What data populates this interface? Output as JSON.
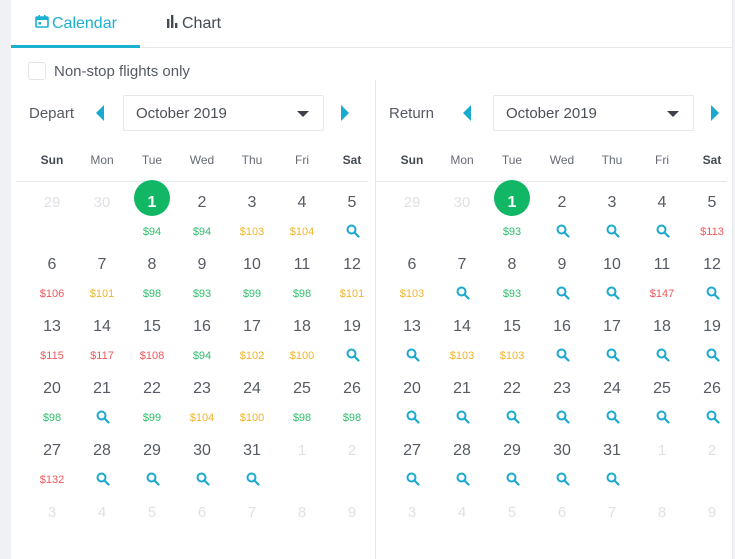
{
  "tabs": [
    {
      "label": "Calendar",
      "icon": "calendar-icon",
      "active": true
    },
    {
      "label": "Chart",
      "icon": "bar-chart-icon",
      "active": false
    }
  ],
  "nonstop": {
    "label": "Non-stop flights only",
    "checked": false
  },
  "colors": {
    "accent": "#1ab0d0",
    "selected": "#12b765",
    "green": "#2fbf6c",
    "orange": "#f0b429",
    "red": "#f2575d"
  },
  "weekdays": [
    "Sun",
    "Mon",
    "Tue",
    "Wed",
    "Thu",
    "Fri",
    "Sat"
  ],
  "calendars": [
    {
      "id": "depart",
      "label": "Depart",
      "month": "October 2019",
      "days": [
        {
          "d": "29",
          "other": true
        },
        {
          "d": "30",
          "other": true
        },
        {
          "d": "1",
          "price": "$94",
          "tier": "green",
          "selected": true
        },
        {
          "d": "2",
          "price": "$94",
          "tier": "green"
        },
        {
          "d": "3",
          "price": "$103",
          "tier": "orange"
        },
        {
          "d": "4",
          "price": "$104",
          "tier": "orange"
        },
        {
          "d": "5",
          "search": true
        },
        {
          "d": "6",
          "price": "$106",
          "tier": "red"
        },
        {
          "d": "7",
          "price": "$101",
          "tier": "orange"
        },
        {
          "d": "8",
          "price": "$98",
          "tier": "green"
        },
        {
          "d": "9",
          "price": "$93",
          "tier": "green"
        },
        {
          "d": "10",
          "price": "$99",
          "tier": "green"
        },
        {
          "d": "11",
          "price": "$98",
          "tier": "green"
        },
        {
          "d": "12",
          "price": "$101",
          "tier": "orange"
        },
        {
          "d": "13",
          "price": "$115",
          "tier": "red"
        },
        {
          "d": "14",
          "price": "$117",
          "tier": "red"
        },
        {
          "d": "15",
          "price": "$108",
          "tier": "red"
        },
        {
          "d": "16",
          "price": "$94",
          "tier": "green"
        },
        {
          "d": "17",
          "price": "$102",
          "tier": "orange"
        },
        {
          "d": "18",
          "price": "$100",
          "tier": "orange"
        },
        {
          "d": "19",
          "search": true
        },
        {
          "d": "20",
          "price": "$98",
          "tier": "green"
        },
        {
          "d": "21",
          "search": true
        },
        {
          "d": "22",
          "price": "$99",
          "tier": "green"
        },
        {
          "d": "23",
          "price": "$104",
          "tier": "orange"
        },
        {
          "d": "24",
          "price": "$100",
          "tier": "orange"
        },
        {
          "d": "25",
          "price": "$98",
          "tier": "green"
        },
        {
          "d": "26",
          "price": "$98",
          "tier": "green"
        },
        {
          "d": "27",
          "price": "$132",
          "tier": "red"
        },
        {
          "d": "28",
          "search": true
        },
        {
          "d": "29",
          "search": true
        },
        {
          "d": "30",
          "search": true
        },
        {
          "d": "31",
          "search": true
        },
        {
          "d": "1",
          "other": true
        },
        {
          "d": "2",
          "other": true
        },
        {
          "d": "3",
          "other": true
        },
        {
          "d": "4",
          "other": true
        },
        {
          "d": "5",
          "other": true
        },
        {
          "d": "6",
          "other": true
        },
        {
          "d": "7",
          "other": true
        },
        {
          "d": "8",
          "other": true
        },
        {
          "d": "9",
          "other": true
        }
      ]
    },
    {
      "id": "return",
      "label": "Return",
      "month": "October 2019",
      "days": [
        {
          "d": "29",
          "other": true
        },
        {
          "d": "30",
          "other": true
        },
        {
          "d": "1",
          "price": "$93",
          "tier": "green",
          "selected": true
        },
        {
          "d": "2",
          "search": true
        },
        {
          "d": "3",
          "search": true
        },
        {
          "d": "4",
          "search": true
        },
        {
          "d": "5",
          "price": "$113",
          "tier": "red"
        },
        {
          "d": "6",
          "price": "$103",
          "tier": "orange"
        },
        {
          "d": "7",
          "search": true
        },
        {
          "d": "8",
          "price": "$93",
          "tier": "green"
        },
        {
          "d": "9",
          "search": true
        },
        {
          "d": "10",
          "search": true
        },
        {
          "d": "11",
          "price": "$147",
          "tier": "red"
        },
        {
          "d": "12",
          "search": true
        },
        {
          "d": "13",
          "search": true
        },
        {
          "d": "14",
          "price": "$103",
          "tier": "orange"
        },
        {
          "d": "15",
          "price": "$103",
          "tier": "orange"
        },
        {
          "d": "16",
          "search": true
        },
        {
          "d": "17",
          "search": true
        },
        {
          "d": "18",
          "search": true
        },
        {
          "d": "19",
          "search": true
        },
        {
          "d": "20",
          "search": true
        },
        {
          "d": "21",
          "search": true
        },
        {
          "d": "22",
          "search": true
        },
        {
          "d": "23",
          "search": true
        },
        {
          "d": "24",
          "search": true
        },
        {
          "d": "25",
          "search": true
        },
        {
          "d": "26",
          "search": true
        },
        {
          "d": "27",
          "search": true
        },
        {
          "d": "28",
          "search": true
        },
        {
          "d": "29",
          "search": true
        },
        {
          "d": "30",
          "search": true
        },
        {
          "d": "31",
          "search": true
        },
        {
          "d": "1",
          "other": true
        },
        {
          "d": "2",
          "other": true
        },
        {
          "d": "3",
          "other": true
        },
        {
          "d": "4",
          "other": true
        },
        {
          "d": "5",
          "other": true
        },
        {
          "d": "6",
          "other": true
        },
        {
          "d": "7",
          "other": true
        },
        {
          "d": "8",
          "other": true
        },
        {
          "d": "9",
          "other": true
        }
      ]
    }
  ]
}
